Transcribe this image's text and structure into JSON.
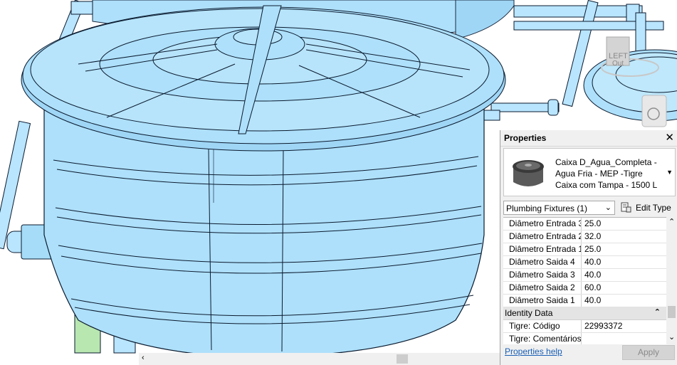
{
  "viewcube": {
    "label_top": "LEFT",
    "label_bottom": "Out"
  },
  "properties": {
    "title": "Properties",
    "close_icon": "close-icon",
    "type_selector": {
      "line1": "Caixa D_Agua_Completa -",
      "line2": "Agua Fria - MEP -Tigre",
      "line3": "Caixa com Tampa - 1500 L"
    },
    "category_filter": "Plumbing Fixtures (1)",
    "edit_type_label": "Edit Type",
    "rows": [
      {
        "name": "Diâmetro Entrada 3",
        "value": "25.0"
      },
      {
        "name": "Diâmetro Entrada 2",
        "value": "32.0"
      },
      {
        "name": "Diâmetro Entrada 1",
        "value": "25.0"
      },
      {
        "name": "Diâmetro Saida 4",
        "value": "40.0"
      },
      {
        "name": "Diâmetro Saida 3",
        "value": "40.0"
      },
      {
        "name": "Diâmetro Saida 2",
        "value": "60.0"
      },
      {
        "name": "Diâmetro Saida 1",
        "value": "40.0"
      }
    ],
    "group_identity": "Identity Data",
    "identity_rows": [
      {
        "name": "Tigre: Código",
        "value": "22993372"
      },
      {
        "name": "Tigre: Comentários",
        "value": ""
      }
    ],
    "help_link": "Properties help",
    "apply_label": "Apply"
  },
  "colors": {
    "tank": "#aee0fb",
    "tank_dark": "#7cc4ea",
    "pipe": "#b9e5ff",
    "panel_bg": "#f0f0f0",
    "link": "#1a5fb4"
  }
}
